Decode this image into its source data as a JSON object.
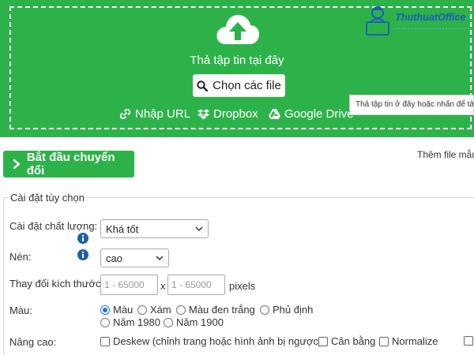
{
  "dropzone": {
    "drop_text": "Thả tập tin tại đây",
    "choose_label": "Chọn các file",
    "links": {
      "url": "Nhập URL",
      "dropbox": "Dropbox",
      "gdrive": "Google Drive"
    },
    "tooltip": "Thả tập tin ở đây hoặc nhấn để tả"
  },
  "logo": {
    "text": "ThuthuatOffice"
  },
  "actions": {
    "start_label": "Bắt đầu chuyển đổi",
    "sample_link": "Thêm file mẫu"
  },
  "options": {
    "title": "Cài đặt tùy chọn",
    "quality": {
      "label": "Cài đặt chất lượng:",
      "value": "Khá tốt"
    },
    "compress": {
      "label": "Nén:",
      "value": "cao"
    },
    "resize": {
      "label": "Thay đổi kích thước:",
      "width_placeholder": "1 - 65000",
      "sep": "x",
      "height_placeholder": "1 - 65000",
      "unit": "pixels"
    },
    "color": {
      "label": "Màu:",
      "items": [
        "Màu",
        "Xám",
        "Màu đen trắng",
        "Phủ định",
        "Năm 1980",
        "Năm 1900"
      ],
      "selected": "Màu"
    },
    "advanced": {
      "label": "Nâng cao:",
      "items": [
        "Deskew (chỉnh trang hoặc hình ảnh bị ngược)",
        "Cân bằng",
        "Normalize"
      ]
    }
  },
  "colors": {
    "brand_green": "#2db24a",
    "radio_blue": "#1e74d6",
    "info_blue": "#1d5fa8"
  }
}
